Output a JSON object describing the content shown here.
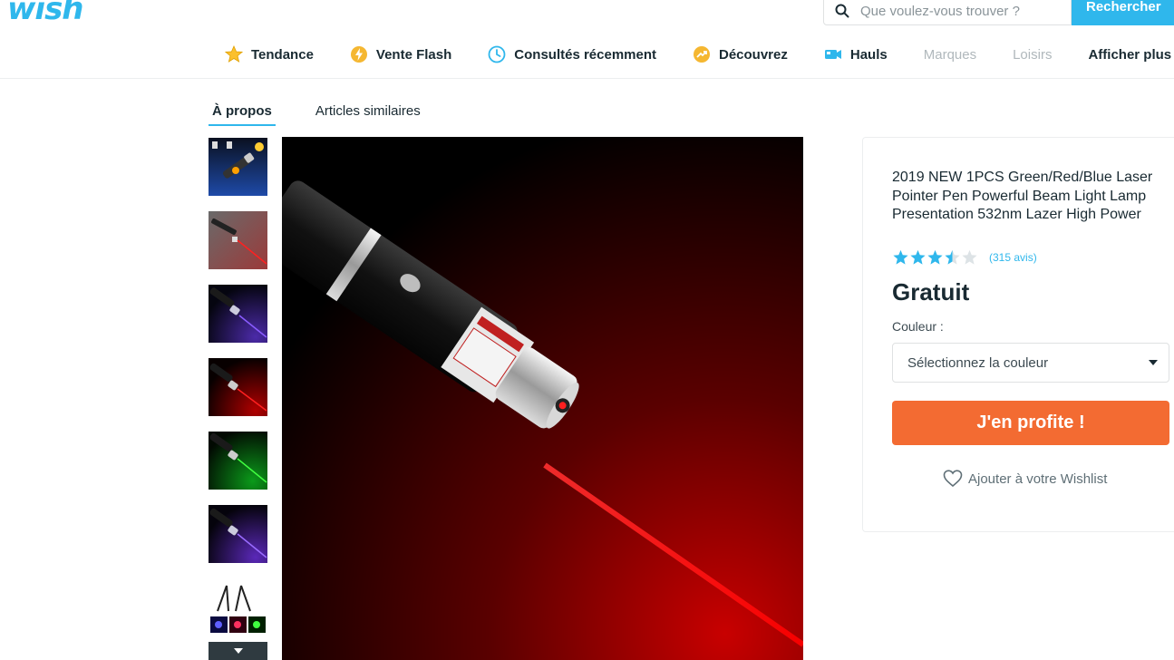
{
  "header": {
    "logo": "wish",
    "search_placeholder": "Que voulez-vous trouver ?",
    "search_button": "Rechercher"
  },
  "nav": {
    "items": [
      {
        "label": "Tendance",
        "icon": "star-icon"
      },
      {
        "label": "Vente Flash",
        "icon": "flash-icon"
      },
      {
        "label": "Consultés récemment",
        "icon": "clock-icon"
      },
      {
        "label": "Découvrez",
        "icon": "trend-icon"
      },
      {
        "label": "Hauls",
        "icon": "video-icon"
      },
      {
        "label": "Marques"
      },
      {
        "label": "Loisirs"
      },
      {
        "label": "Afficher plus"
      }
    ]
  },
  "tabs": [
    {
      "label": "À propos",
      "active": true
    },
    {
      "label": "Articles similaires",
      "active": false
    }
  ],
  "product": {
    "title": "2019 NEW 1PCS Green/Red/Blue Laser Pointer Pen Powerful Beam Light Lamp Presentation 532nm Lazer High Power",
    "rating": 3.5,
    "reviews": "(315 avis)",
    "price": "Gratuit",
    "color_label": "Couleur :",
    "color_select": "Sélectionnez la couleur",
    "buy_button": "J'en profite !",
    "wishlist": "Ajouter à votre Wishlist"
  },
  "thumbnails": [
    "blue-laser-set",
    "red-laser-grey",
    "blue-violet-laser",
    "red-laser",
    "green-laser",
    "violet-laser",
    "tripod-lasers"
  ],
  "colors": {
    "brand": "#2fb7ec",
    "cta": "#f36b32",
    "star": "#2fb7ec"
  }
}
